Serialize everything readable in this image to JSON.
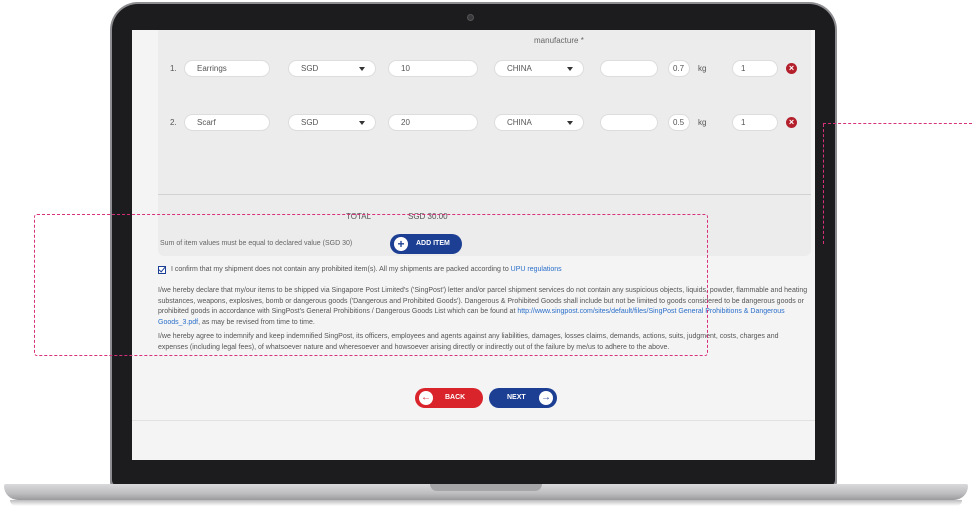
{
  "form": {
    "column_header": "manufacture *",
    "items": [
      {
        "num": "1.",
        "name": "Earrings",
        "currency": "SGD",
        "value": "10",
        "country": "CHINA",
        "extra": "",
        "weight": "0.7",
        "unit": "kg",
        "qty": "1"
      },
      {
        "num": "2.",
        "name": "Scarf",
        "currency": "SGD",
        "value": "20",
        "country": "CHINA",
        "extra": "",
        "weight": "0.5",
        "unit": "kg",
        "qty": "1"
      }
    ],
    "total_label": "TOTAL",
    "total_value": "SGD 30.00",
    "sum_note": "Sum of item values must be equal to declared value (SGD 30)",
    "add_item_label": "ADD ITEM"
  },
  "declaration": {
    "confirm_text": "I confirm that my shipment does not contain any prohibited item(s). All my shipments are packed according to",
    "confirm_link": "UPU regulations",
    "para1": "I/we hereby declare that my/our items to be shipped via Singapore Post Limited's ('SingPost') letter and/or parcel shipment services do not contain any suspicious objects, liquids, powder, flammable and heating substances, weapons, explosives, bomb or dangerous goods ('Dangerous and Prohibited Goods'). Dangerous & Prohibited Goods shall include but not be limited to goods considered to be dangerous goods or prohibited goods in accordance with SingPost's General Prohibitions / Dangerous Goods List which can be found at",
    "para1_link": "http://www.singpost.com/sites/default/files/SingPost General Prohibitions & Dangerous Goods_3.pdf",
    "para1_tail": ", as may be revised from time to time.",
    "para2": "I/we hereby agree to indemnify and keep indemnified SingPost, its officers, employees and agents against any liabilities, damages, losses claims, demands, actions, suits, judgment, costs, charges and expenses (including legal fees), of whatsoever nature and wheresoever and howsoever arising directly or indirectly out of the failure by me/us to adhere to the above."
  },
  "nav": {
    "back_label": "BACK",
    "next_label": "NEXT"
  },
  "icons": {
    "add": "plus-circle-icon",
    "back": "arrow-left-circle-icon",
    "next": "arrow-right-circle-icon",
    "delete": "close-circle-icon"
  },
  "colors": {
    "primary": "#1c3f94",
    "danger": "#d9242b",
    "annotation": "#d8317c",
    "link": "#2a6fc9"
  }
}
